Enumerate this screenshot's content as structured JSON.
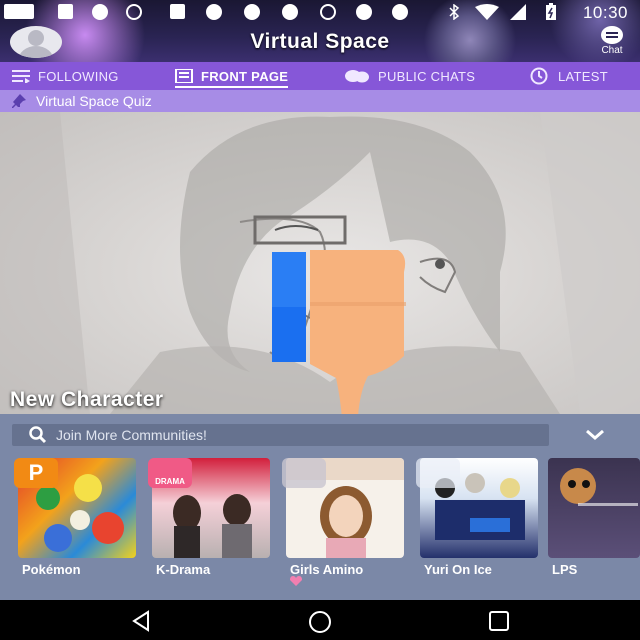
{
  "status_bar": {
    "time": "10:30"
  },
  "header": {
    "title": "Virtual Space",
    "chat_label": "Chat"
  },
  "tabs": [
    {
      "label": "FOLLOWING",
      "icon": "list-icon",
      "active": false
    },
    {
      "label": "FRONT PAGE",
      "icon": "newspaper-icon",
      "active": true
    },
    {
      "label": "PUBLIC CHATS",
      "icon": "chat-bubbles-icon",
      "active": false
    },
    {
      "label": "LATEST",
      "icon": "clock-icon",
      "active": false
    }
  ],
  "pinned": {
    "label": "Virtual Space Quiz",
    "icon": "pin-icon"
  },
  "featured_post": {
    "title": "New Character"
  },
  "search": {
    "placeholder": "Join More Communities!"
  },
  "communities": [
    {
      "name": "Pokémon",
      "badge": "P"
    },
    {
      "name": "K-Drama",
      "badge": "DRAMA"
    },
    {
      "name": "Girls Amino",
      "badge": ""
    },
    {
      "name": "Yuri On Ice",
      "badge": ""
    },
    {
      "name": "LPS",
      "badge": ""
    }
  ],
  "colors": {
    "tab_bar": "#8657d8",
    "pinned_bar": "#a78ce6",
    "panel": "#7b88a7",
    "like_blue": "#1a6ff0",
    "like_skin": "#f7b27d"
  }
}
